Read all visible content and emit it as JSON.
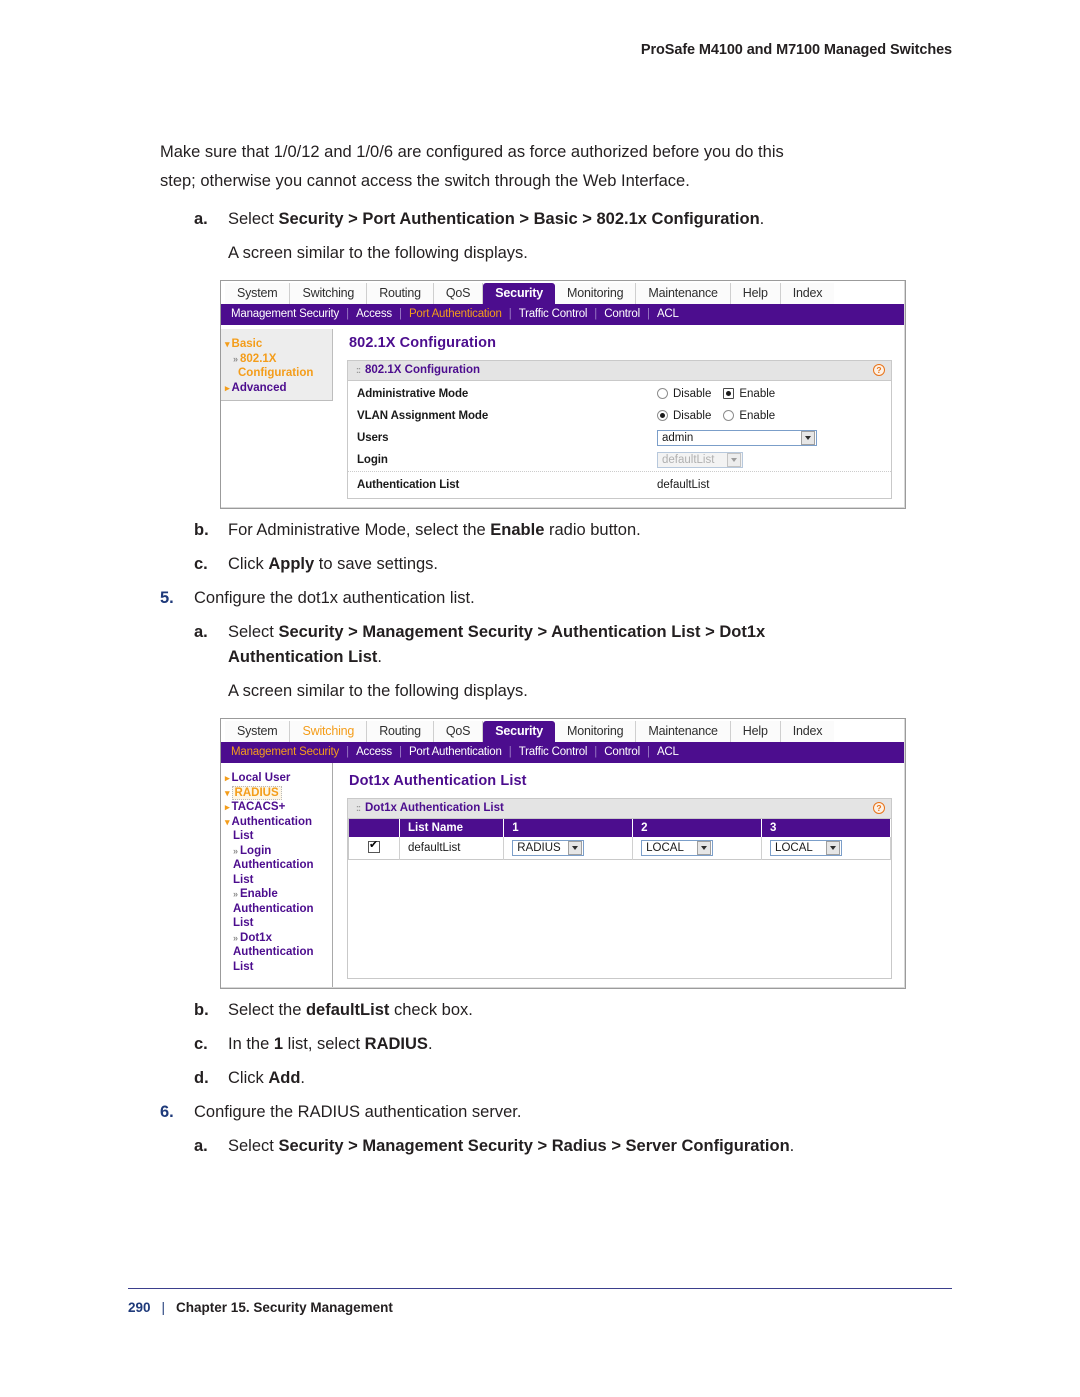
{
  "header": {
    "title": "ProSafe M4100 and M7100 Managed Switches"
  },
  "body": {
    "intro_line1": "Make sure that 1/0/12 and 1/0/6 are configured as force authorized before you do this",
    "intro_line2": "step; otherwise you cannot access the switch through the Web Interface.",
    "step4a_marker": "a.",
    "step4a_pre": "Select ",
    "step4a_path": "Security > Port Authentication > Basic > 802.1x Configuration",
    "step4a_post": ".",
    "screen_note_1": "A screen similar to the following displays.",
    "step4b_marker": "b.",
    "step4b_pre": "For Administrative Mode, select the ",
    "step4b_bold": "Enable",
    "step4b_post": " radio button.",
    "step4c_marker": "c.",
    "step4c_pre": "Click ",
    "step4c_bold": "Apply",
    "step4c_post": " to save settings.",
    "step5_marker": "5.",
    "step5_text": "Configure the dot1x authentication list.",
    "step5a_marker": "a.",
    "step5a_pre": "Select ",
    "step5a_path_line1": "Security > Management Security > Authentication List > Dot1x",
    "step5a_path_line2": "Authentication List",
    "step5a_post": ".",
    "screen_note_2": "A screen similar to the following displays.",
    "step5b_marker": "b.",
    "step5b_pre": "Select the ",
    "step5b_bold": "defaultList",
    "step5b_post": " check box.",
    "step5c_marker": "c.",
    "step5c_pre": "In the ",
    "step5c_bold1": "1",
    "step5c_mid": " list, select ",
    "step5c_bold2": "RADIUS",
    "step5c_post": ".",
    "step5d_marker": "d.",
    "step5d_pre": "Click ",
    "step5d_bold": "Add",
    "step5d_post": ".",
    "step6_marker": "6.",
    "step6_text": "Configure the RADIUS authentication server.",
    "step6a_marker": "a.",
    "step6a_pre": "Select ",
    "step6a_path": "Security > Management Security > Radius > Server Configuration",
    "step6a_post": "."
  },
  "screenshot1": {
    "tabs": [
      {
        "label": "System",
        "state": "normal"
      },
      {
        "label": "Switching",
        "state": "normal"
      },
      {
        "label": "Routing",
        "state": "normal"
      },
      {
        "label": "QoS",
        "state": "normal"
      },
      {
        "label": "Security",
        "state": "active"
      },
      {
        "label": "Monitoring",
        "state": "normal"
      },
      {
        "label": "Maintenance",
        "state": "normal"
      },
      {
        "label": "Help",
        "state": "normal"
      },
      {
        "label": "Index",
        "state": "normal"
      }
    ],
    "subnav": [
      {
        "label": "Management Security",
        "state": "normal"
      },
      {
        "label": "Access",
        "state": "normal"
      },
      {
        "label": "Port Authentication",
        "state": "selected"
      },
      {
        "label": "Traffic Control",
        "state": "normal"
      },
      {
        "label": "Control",
        "state": "normal"
      },
      {
        "label": "ACL",
        "state": "normal"
      }
    ],
    "sidebar": [
      {
        "label": "Basic",
        "color": "orange"
      },
      {
        "label": "802.1X",
        "color": "orange"
      },
      {
        "label": "Configuration",
        "color": "orange"
      },
      {
        "label": "Advanced",
        "color": "purple"
      }
    ],
    "page_title": "802.1X Configuration",
    "panel_title": "802.1X Configuration",
    "help_glyph": "?",
    "rows": {
      "admin_mode_label": "Administrative Mode",
      "admin_mode_opt1": "Disable",
      "admin_mode_opt2": "Enable",
      "vlan_mode_label": "VLAN Assignment Mode",
      "vlan_mode_opt1": "Disable",
      "vlan_mode_opt2": "Enable",
      "users_label": "Users",
      "users_value": "admin",
      "login_label": "Login",
      "login_value": "defaultList",
      "auth_list_label": "Authentication List",
      "auth_list_value": "defaultList"
    }
  },
  "screenshot2": {
    "tabs": [
      {
        "label": "System",
        "state": "normal"
      },
      {
        "label": "Switching",
        "state": "hover"
      },
      {
        "label": "Routing",
        "state": "normal"
      },
      {
        "label": "QoS",
        "state": "normal"
      },
      {
        "label": "Security",
        "state": "active"
      },
      {
        "label": "Monitoring",
        "state": "normal"
      },
      {
        "label": "Maintenance",
        "state": "normal"
      },
      {
        "label": "Help",
        "state": "normal"
      },
      {
        "label": "Index",
        "state": "normal"
      }
    ],
    "subnav": [
      {
        "label": "Management Security",
        "state": "selected"
      },
      {
        "label": "Access",
        "state": "normal"
      },
      {
        "label": "Port Authentication",
        "state": "normal"
      },
      {
        "label": "Traffic Control",
        "state": "normal"
      },
      {
        "label": "Control",
        "state": "normal"
      },
      {
        "label": "ACL",
        "state": "normal"
      }
    ],
    "sidebar": [
      {
        "label": "Local User",
        "color": "purple",
        "indent": 0,
        "marker": "arrow"
      },
      {
        "label": "RADIUS",
        "color": "sel",
        "indent": 0,
        "marker": "arrow"
      },
      {
        "label": "TACACS+",
        "color": "purple",
        "indent": 0,
        "marker": "arrow"
      },
      {
        "label": "Authentication",
        "color": "purple",
        "indent": 0,
        "marker": "arrow"
      },
      {
        "label": "List",
        "color": "purple",
        "indent": 1,
        "marker": "none"
      },
      {
        "label": "Login",
        "color": "purple",
        "indent": 1,
        "marker": "chev"
      },
      {
        "label": "Authentication",
        "color": "purple",
        "indent": 1,
        "marker": "none"
      },
      {
        "label": "List",
        "color": "purple",
        "indent": 1,
        "marker": "none"
      },
      {
        "label": "Enable",
        "color": "purple",
        "indent": 1,
        "marker": "chev"
      },
      {
        "label": "Authentication",
        "color": "purple",
        "indent": 1,
        "marker": "none"
      },
      {
        "label": "List",
        "color": "purple",
        "indent": 1,
        "marker": "none"
      },
      {
        "label": "Dot1x",
        "color": "purple",
        "indent": 1,
        "marker": "chev"
      },
      {
        "label": "Authentication",
        "color": "purple",
        "indent": 1,
        "marker": "none"
      },
      {
        "label": "List",
        "color": "purple",
        "indent": 1,
        "marker": "none"
      }
    ],
    "page_title": "Dot1x Authentication List",
    "panel_title": "Dot1x Authentication List",
    "help_glyph": "?",
    "table": {
      "headers": [
        "",
        "List Name",
        "1",
        "2",
        "3"
      ],
      "row": {
        "checked": true,
        "list_name": "defaultList",
        "col1": "RADIUS",
        "col2": "LOCAL",
        "col3": "LOCAL"
      }
    }
  },
  "footer": {
    "page_number": "290",
    "separator": "|",
    "chapter": "Chapter 15. Security Management"
  },
  "colors": {
    "purple": "#4c0d8e",
    "orange": "#f49d1a",
    "header_gray": "#e4e4e4",
    "number_blue": "#1f3a7a"
  }
}
